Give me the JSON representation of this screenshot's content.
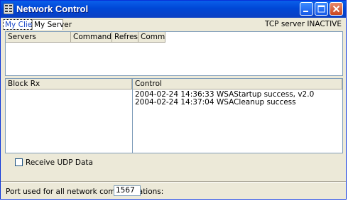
{
  "window": {
    "title": "Network Control"
  },
  "tabs": [
    {
      "label": "My Client",
      "active": true
    },
    {
      "label": "My Server",
      "active": false
    }
  ],
  "status": "TCP server INACTIVE",
  "servers_table": {
    "columns": [
      "Servers",
      "Command",
      "Refresh",
      "Comment"
    ],
    "rows": []
  },
  "block_rx": {
    "header": "Block Rx"
  },
  "control": {
    "header": "Control",
    "log": [
      "2004-02-24 14:36:33  WSAStartup success, v2.0",
      "2004-02-24 14:37:04  WSACleanup success"
    ]
  },
  "receive_udp": {
    "label": "Receive UDP Data",
    "checked": false
  },
  "port": {
    "label": "Port used for all network communications:",
    "value": "1567"
  },
  "colors": {
    "titlebar": "#0047D6",
    "face": "#ECE9D8",
    "close": "#C9461F"
  }
}
